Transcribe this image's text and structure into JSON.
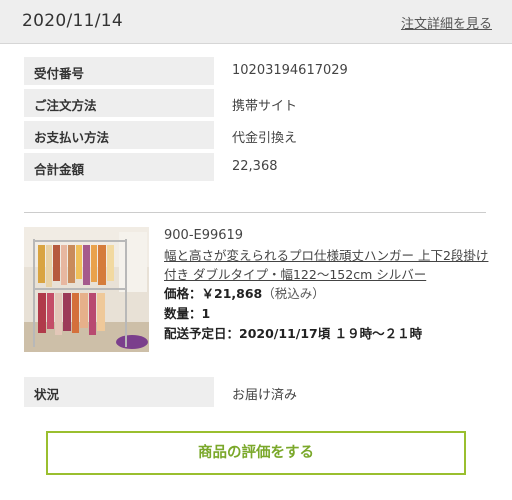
{
  "header": {
    "date": "2020/11/14",
    "detail_link": "注文詳細を見る"
  },
  "order_info": [
    {
      "label": "受付番号",
      "value": "10203194617029"
    },
    {
      "label": "ご注文方法",
      "value": "携帯サイト"
    },
    {
      "label": "お支払い方法",
      "value": "代金引換え"
    },
    {
      "label": "合計金額",
      "value": "22,368"
    }
  ],
  "product": {
    "code": "900-E99619",
    "name": "幅と高さが変えられるプロ仕様頑丈ハンガー 上下2段掛け付き ダブルタイプ・幅122〜152cm シルバー",
    "price_label": "価格：",
    "price_value": "￥21,868",
    "price_tax": "（税込み）",
    "quantity_label": "数量：",
    "quantity_value": "1",
    "delivery_label": "配送予定日：",
    "delivery_value": "2020/11/17頃 １９時〜２１時"
  },
  "status": {
    "label": "状況",
    "value": "お届け済み"
  },
  "review_button": "商品の評価をする",
  "colors": {
    "accent_green": "#9abf2f",
    "label_bg": "#eeeeee"
  }
}
